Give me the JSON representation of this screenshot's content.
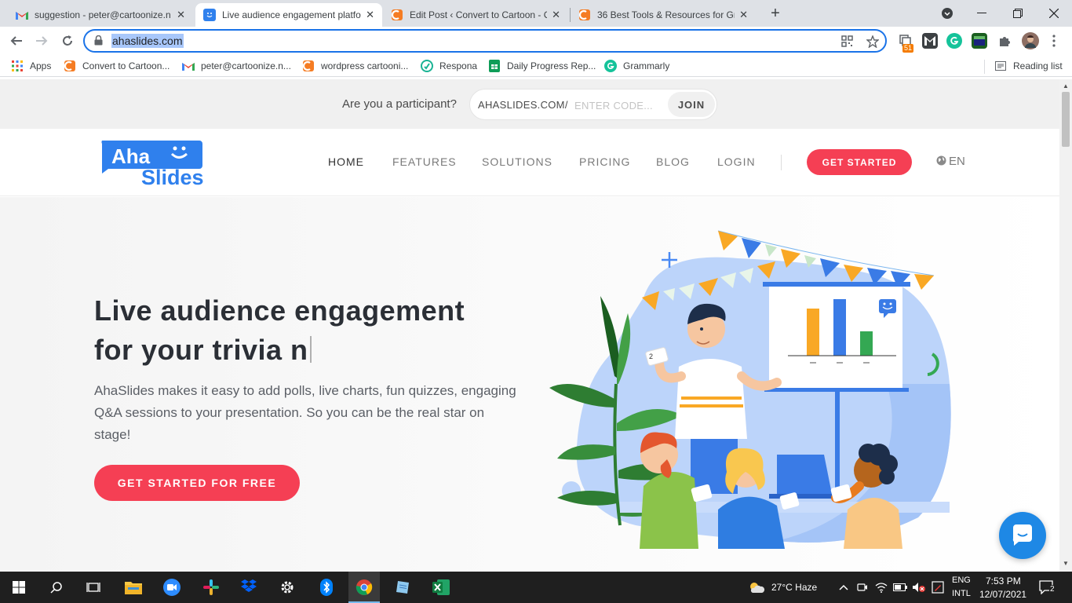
{
  "browser": {
    "tabs": [
      {
        "label": "suggestion - peter@cartoonize.n",
        "favicon": "gmail-icon",
        "active": false
      },
      {
        "label": "Live audience engagement platfo",
        "favicon": "ahaslides-icon",
        "active": true
      },
      {
        "label": "Edit Post ‹ Convert to Cartoon - C",
        "favicon": "cartoonize-icon",
        "active": false
      },
      {
        "label": "36 Best Tools & Resources for Gr",
        "favicon": "cartoonize-icon",
        "active": false
      }
    ],
    "close_glyph": "✕",
    "new_tab_glyph": "+",
    "url": "ahaslides.com",
    "extensions": {
      "badge_count": "51"
    },
    "bookmarks": [
      {
        "label": "Apps",
        "icon": "apps-grid-icon"
      },
      {
        "label": "Convert to Cartoon...",
        "icon": "cartoonize-icon"
      },
      {
        "label": "peter@cartoonize.n...",
        "icon": "gmail-icon"
      },
      {
        "label": "wordpress cartooni...",
        "icon": "cartoonize-icon"
      },
      {
        "label": "Respona",
        "icon": "respona-icon"
      },
      {
        "label": "Daily Progress Rep...",
        "icon": "sheets-icon"
      },
      {
        "label": "Grammarly",
        "icon": "grammarly-icon"
      }
    ],
    "reading_list": "Reading list"
  },
  "page": {
    "participant_bar": {
      "label": "Are you a participant?",
      "prefix": "AHASLIDES.COM/",
      "placeholder": "ENTER CODE...",
      "join_label": "JOIN"
    },
    "logo": {
      "line1": "Aha",
      "line2": "Slides"
    },
    "nav": {
      "items": [
        "HOME",
        "FEATURES",
        "SOLUTIONS",
        "PRICING",
        "BLOG",
        "LOGIN"
      ],
      "cta": "GET STARTED",
      "language": "EN"
    },
    "hero": {
      "title_line1": "Live audience engagement",
      "title_line2": "for your trivia n",
      "description": "AhaSlides makes it easy to add polls, live charts, fun quizzes, engaging Q&A sessions to your presentation. So you can be the real star on stage!",
      "cta": "GET STARTED FOR FREE"
    },
    "illustration": {
      "card_number": "2"
    }
  },
  "taskbar": {
    "weather": "27°C  Haze",
    "lang_line1": "ENG",
    "lang_line2": "INTL",
    "time": "7:53 PM",
    "date": "12/07/2021",
    "notification_count": "2"
  },
  "colors": {
    "accent_red": "#f53f54",
    "brand_blue": "#2f80ed",
    "chrome_focus": "#1a73e8"
  }
}
